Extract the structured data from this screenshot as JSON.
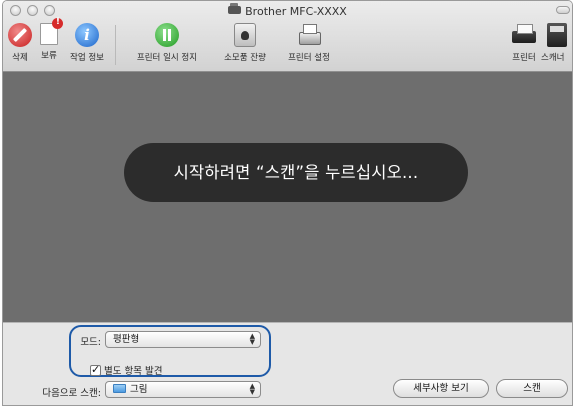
{
  "window": {
    "title": "Brother MFC-XXXX"
  },
  "toolbar": {
    "delete": "삭제",
    "hold": "보류",
    "job_info": "작업 정보",
    "pause_printer": "프린터 일시 정지",
    "supply_levels": "소모품 잔량",
    "printer_setup": "프린터 설정",
    "printer": "프린터",
    "scanner": "스캐너"
  },
  "preview": {
    "message": "시작하려면 “스캔”을 누르십시오..."
  },
  "controls": {
    "mode_label": "모드:",
    "mode_value": "평판형",
    "detect_label": "별도 항목 발견",
    "detect_checked": true,
    "scan_to_label": "다음으로 스캔:",
    "scan_to_value": "그림",
    "details_button": "세부사항 보기",
    "scan_button": "스캔"
  },
  "colors": {
    "highlight": "#1e5aa8",
    "preview_bg": "#6e6e6e",
    "hud_bg": "#262626"
  }
}
